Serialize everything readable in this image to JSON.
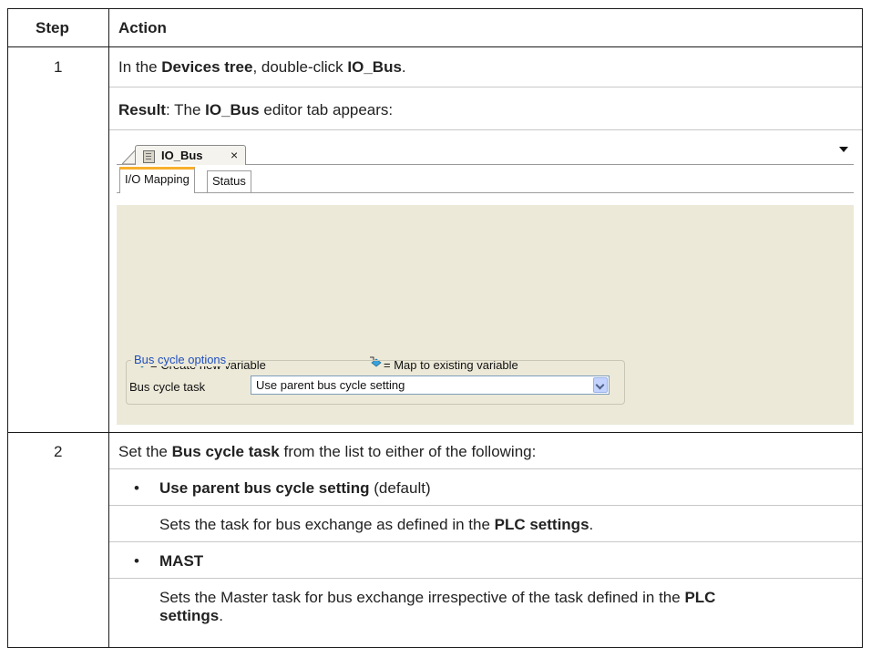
{
  "table": {
    "header_step": "Step",
    "header_action": "Action",
    "rows": [
      {
        "step": "1",
        "line1": {
          "pre": "In the ",
          "b1": "Devices tree",
          "mid": ", double-click ",
          "b2": "IO_Bus",
          "post": "."
        },
        "line2": {
          "b1": "Result",
          "mid": ": The ",
          "b2": "IO_Bus",
          "post": " editor tab appears:"
        }
      },
      {
        "step": "2",
        "line1": {
          "pre": "Set the ",
          "b1": "Bus cycle task",
          "post": " from the list to either of the following:"
        },
        "bullet_char": "•",
        "opt1": {
          "b": "Use parent bus cycle setting",
          "post": " (default)"
        },
        "opt1_desc": {
          "pre": "Sets the task for bus exchange as defined in the ",
          "b": "PLC settings",
          "post": "."
        },
        "opt2": {
          "b": "MAST"
        },
        "opt2_desc": {
          "pre": "Sets the Master task for bus exchange irrespective of the task defined in the ",
          "b1": "PLC",
          "b2": "settings",
          "post": "."
        }
      }
    ]
  },
  "screenshot": {
    "editor_tab": {
      "label": "IO_Bus",
      "close": "×"
    },
    "subtabs": [
      "I/O Mapping",
      "Status"
    ],
    "legend": {
      "create": "= Create new variable",
      "map": "= Map to existing variable"
    },
    "group_title": "Bus cycle options",
    "field_label": "Bus cycle task",
    "select_value": "Use parent bus cycle setting",
    "colors": {
      "panel": "#ece9d8",
      "group_title": "#1f4fbf",
      "active_tab": "#f7b02b"
    }
  }
}
